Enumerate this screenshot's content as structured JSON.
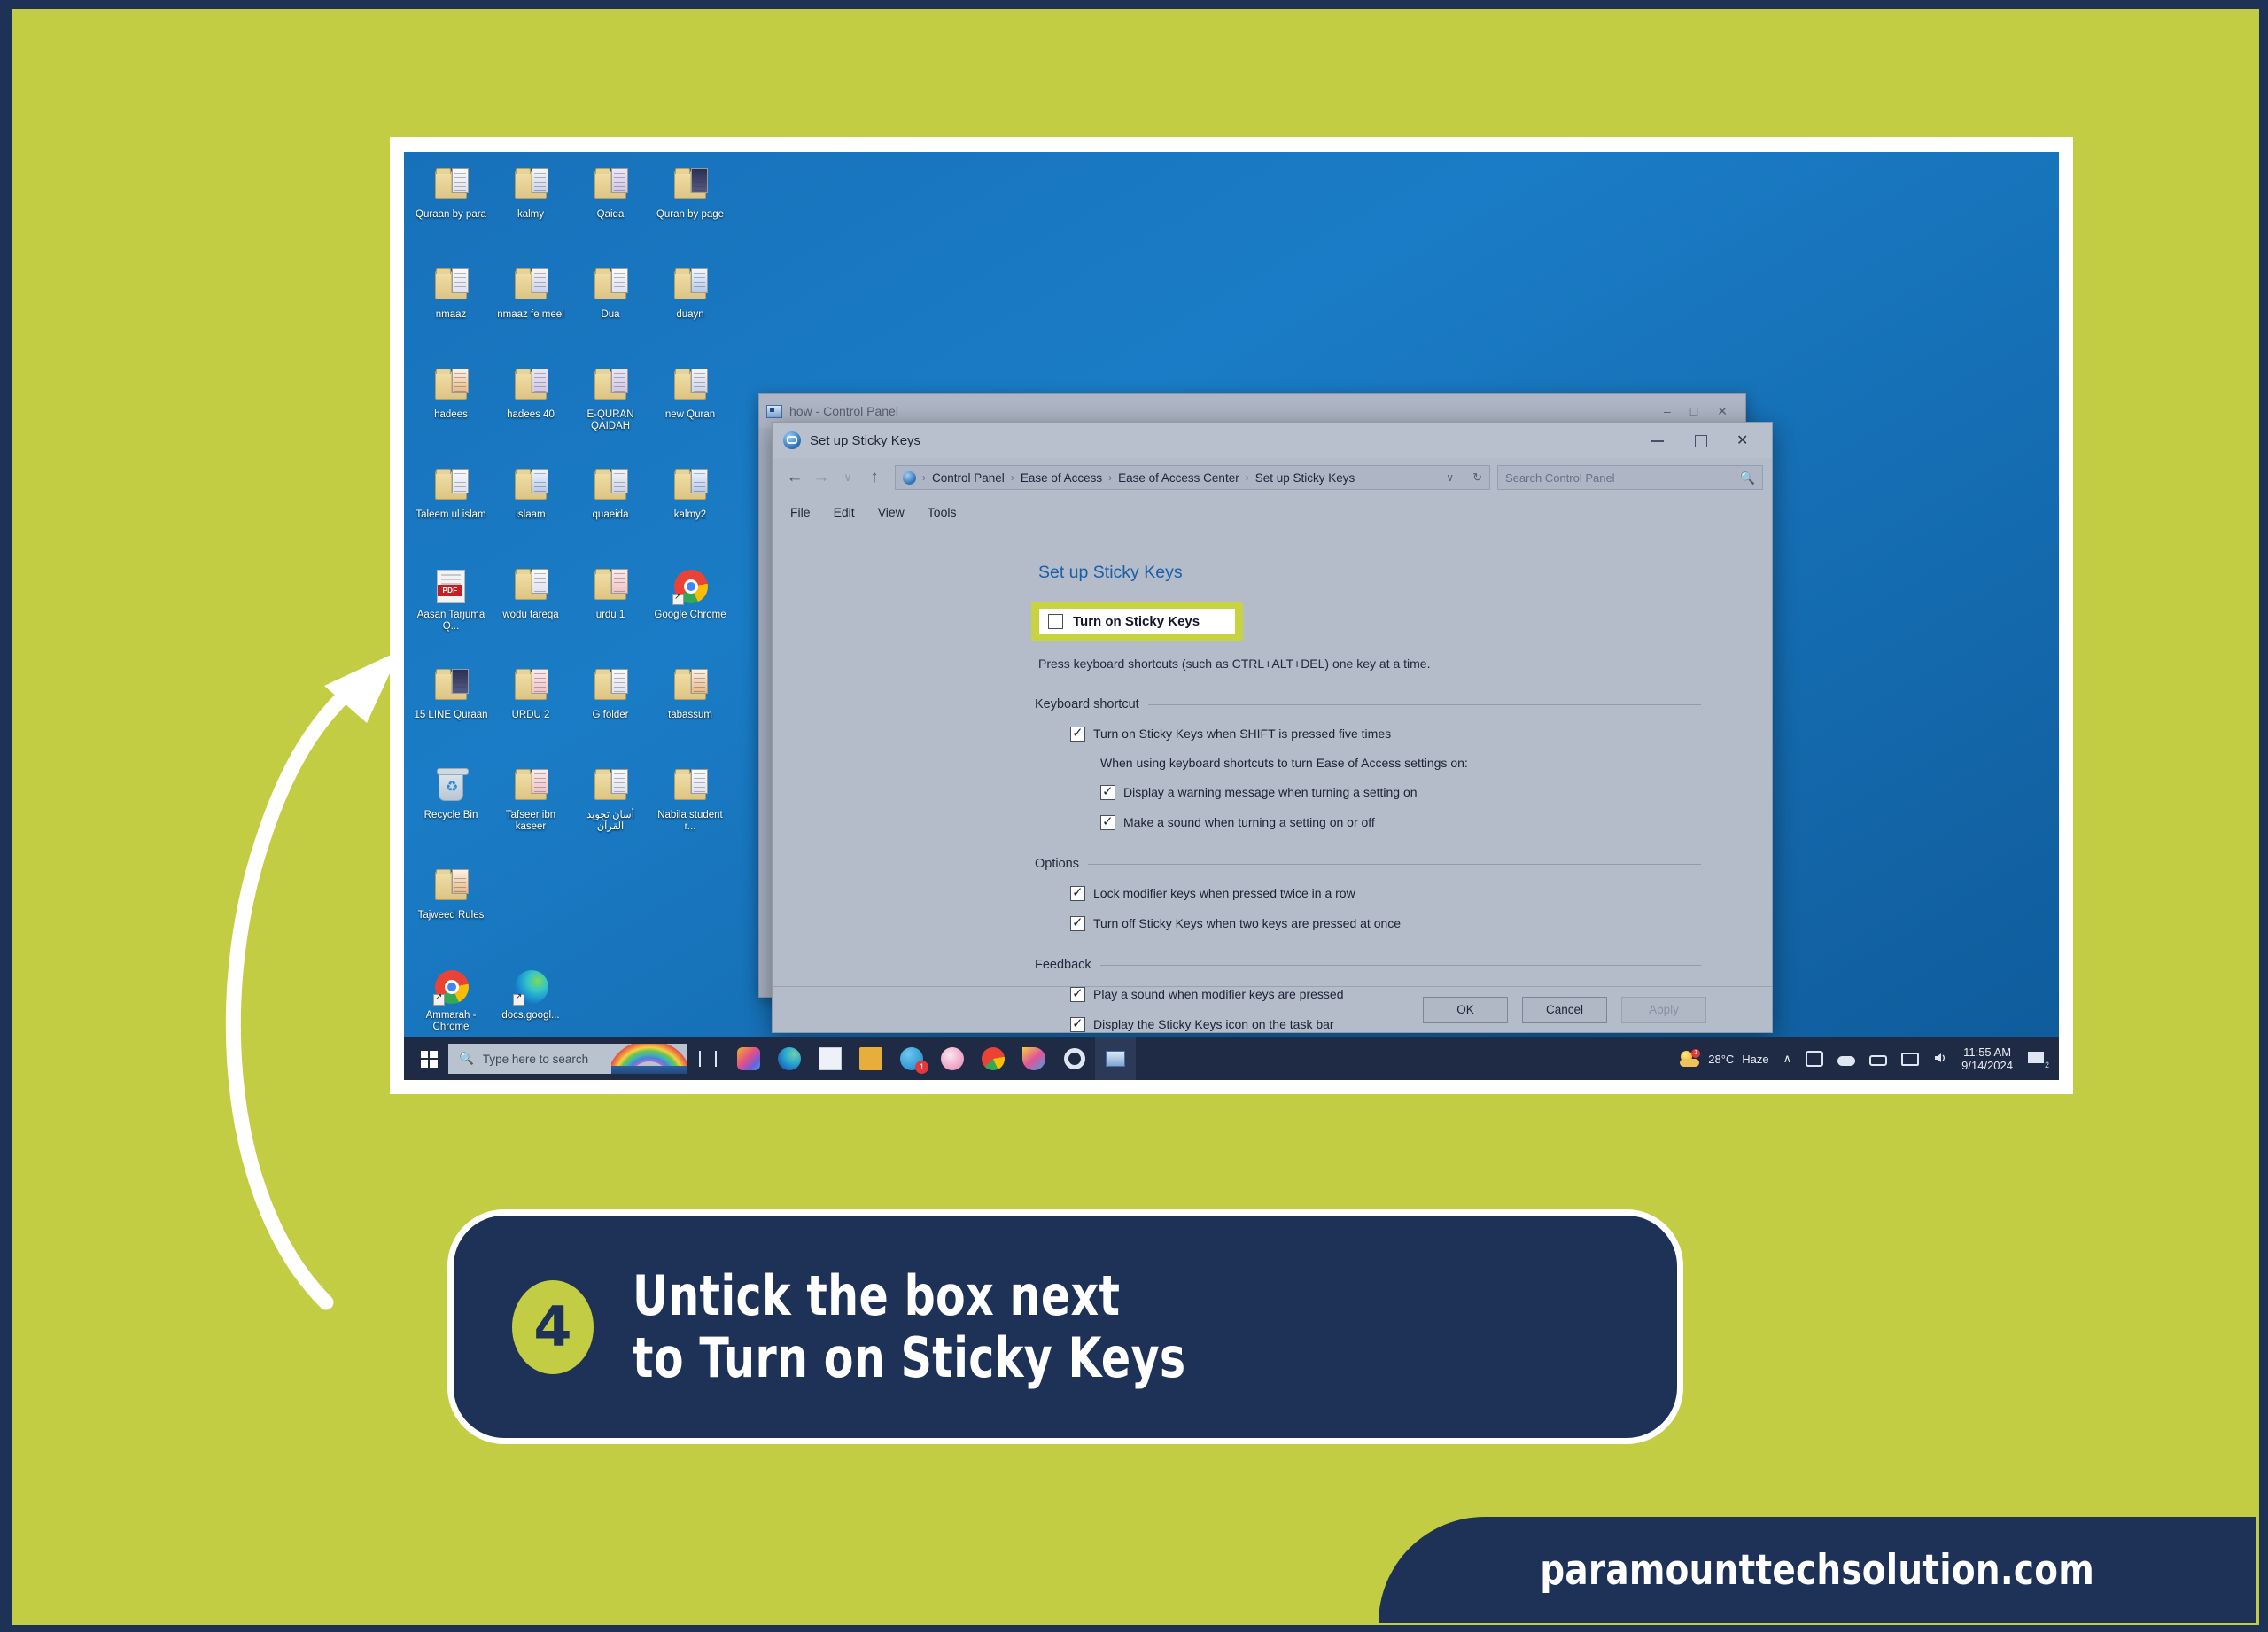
{
  "theme": {
    "lime": "#c2cd44",
    "navy": "#1e3258",
    "highlight": "#c8d340",
    "desktop_blue": "#1771ba",
    "taskbar": "#1f2a44"
  },
  "desktop": {
    "icons": [
      {
        "label": "Quraan by para",
        "type": "folder-paper",
        "tint": "tint-a"
      },
      {
        "label": "kalmy",
        "type": "folder-paper",
        "tint": "tint-d"
      },
      {
        "label": "Qaida",
        "type": "folder-paper",
        "tint": "tint-b"
      },
      {
        "label": "Quran by page",
        "type": "folder-paper",
        "tint": "tint-f"
      },
      {
        "label": "nmaaz",
        "type": "folder-paper",
        "tint": "tint-a"
      },
      {
        "label": "nmaaz fe meel",
        "type": "folder-paper",
        "tint": "tint-d"
      },
      {
        "label": "Dua",
        "type": "folder-paper",
        "tint": "tint-a"
      },
      {
        "label": "duayn",
        "type": "folder-paper",
        "tint": "tint-g"
      },
      {
        "label": "hadees",
        "type": "folder-paper",
        "tint": "tint-c"
      },
      {
        "label": "hadees 40",
        "type": "folder-paper",
        "tint": "tint-b"
      },
      {
        "label": "E-QURAN QAIDAH",
        "type": "folder-paper",
        "tint": "tint-b"
      },
      {
        "label": "new Quran",
        "type": "folder-paper",
        "tint": "tint-d"
      },
      {
        "label": "Taleem ul islam",
        "type": "folder-paper",
        "tint": "tint-a"
      },
      {
        "label": "islaam",
        "type": "folder-paper",
        "tint": "tint-g"
      },
      {
        "label": "quaeida",
        "type": "folder-paper",
        "tint": "tint-d"
      },
      {
        "label": "kalmy2",
        "type": "folder-paper",
        "tint": "tint-g"
      },
      {
        "label": "Aasan Tarjuma Q...",
        "type": "pdf",
        "tint": ""
      },
      {
        "label": "wodu tareqa",
        "type": "folder-paper",
        "tint": "tint-a"
      },
      {
        "label": "urdu 1",
        "type": "folder-paper",
        "tint": "tint-e"
      },
      {
        "label": "Google Chrome",
        "type": "chrome-shortcut",
        "tint": ""
      },
      {
        "label": "15 LINE Quraan",
        "type": "folder-paper",
        "tint": "tint-f"
      },
      {
        "label": "URDU 2",
        "type": "folder-paper",
        "tint": "tint-e"
      },
      {
        "label": "G folder",
        "type": "folder-paper",
        "tint": "tint-a"
      },
      {
        "label": "tabassum",
        "type": "folder-paper",
        "tint": "tint-c"
      },
      {
        "label": "Recycle Bin",
        "type": "recycle-bin",
        "tint": ""
      },
      {
        "label": "Tafseer ibn kaseer",
        "type": "folder-paper",
        "tint": "tint-e"
      },
      {
        "label": "أسان تجوید القرآن",
        "type": "folder-paper",
        "tint": "tint-a"
      },
      {
        "label": "Nabila student r...",
        "type": "folder-paper",
        "tint": "tint-a"
      },
      {
        "label": "Tajweed Rules",
        "type": "folder-paper",
        "tint": "tint-c"
      },
      {
        "label": "",
        "type": "blank",
        "tint": ""
      },
      {
        "label": "",
        "type": "blank",
        "tint": ""
      },
      {
        "label": "",
        "type": "blank",
        "tint": ""
      },
      {
        "label": "Ammarah - Chrome",
        "type": "chrome-shortcut",
        "tint": ""
      },
      {
        "label": "docs.googl...",
        "type": "edge-shortcut",
        "tint": ""
      }
    ]
  },
  "background_window": {
    "title": "how - Control Panel",
    "menu": [
      "File",
      "Edit",
      "View",
      "Tools"
    ]
  },
  "dialog": {
    "title": "Set up Sticky Keys",
    "window_buttons": {
      "minimize": "–",
      "maximize": "□",
      "close": "✕"
    },
    "breadcrumb": [
      "Control Panel",
      "Ease of Access",
      "Ease of Access Center",
      "Set up Sticky Keys"
    ],
    "breadcrumb_separator": "›",
    "address_dropdown": "∨",
    "refresh": "↻",
    "nav": {
      "back": "←",
      "forward": "→",
      "recent": "∨",
      "up": "↑"
    },
    "search": {
      "placeholder": "Search Control Panel",
      "icon": "search-icon"
    },
    "menu": [
      "File",
      "Edit",
      "View",
      "Tools"
    ],
    "heading": "Set up Sticky Keys",
    "main_checkbox": {
      "label": "Turn on Sticky Keys",
      "checked": false,
      "highlighted": true
    },
    "hint": "Press keyboard shortcuts (such as CTRL+ALT+DEL) one key at a time.",
    "groups": [
      {
        "title": "Keyboard shortcut",
        "items": [
          {
            "label": "Turn on Sticky Keys when SHIFT is pressed five times",
            "checked": true,
            "indent": 1
          },
          {
            "label": "When using keyboard shortcuts to turn Ease of Access settings on:",
            "checked": null,
            "indent": 2
          },
          {
            "label": "Display a warning message when turning a setting on",
            "checked": true,
            "indent": 2
          },
          {
            "label": "Make a sound when turning a setting on or off",
            "checked": true,
            "indent": 2
          }
        ]
      },
      {
        "title": "Options",
        "items": [
          {
            "label": "Lock modifier keys when pressed twice in a row",
            "checked": true,
            "indent": 1
          },
          {
            "label": "Turn off Sticky Keys when two keys are pressed at once",
            "checked": true,
            "indent": 1
          }
        ]
      },
      {
        "title": "Feedback",
        "items": [
          {
            "label": "Play a sound when modifier keys are pressed",
            "checked": true,
            "indent": 1
          },
          {
            "label": "Display the Sticky Keys icon on the task bar",
            "checked": true,
            "indent": 1
          }
        ]
      }
    ],
    "buttons": {
      "ok": "OK",
      "cancel": "Cancel",
      "apply": "Apply",
      "apply_disabled": true
    }
  },
  "taskbar": {
    "start": "start-button",
    "search_placeholder": "Type here to search",
    "search_icon": "search-icon",
    "icons": [
      {
        "name": "task-view-icon"
      },
      {
        "name": "widgets-icon"
      },
      {
        "name": "edge-icon"
      },
      {
        "name": "mail-icon"
      },
      {
        "name": "file-explorer-icon"
      },
      {
        "name": "skype-icon",
        "badge": "1"
      },
      {
        "name": "snip-sketch-icon"
      },
      {
        "name": "chrome-icon"
      },
      {
        "name": "paint-icon"
      },
      {
        "name": "settings-icon"
      },
      {
        "name": "control-panel-icon",
        "active": true
      }
    ],
    "tray": {
      "weather_temp": "28°C",
      "weather_desc": "Haze",
      "weather_badge": "1",
      "chevron": "∧",
      "icons": [
        "onedrive-icon",
        "cloud-icon",
        "battery-icon",
        "network-icon",
        "volume-icon"
      ],
      "time": "11:55 AM",
      "date": "9/14/2024",
      "notification_badge": "2"
    }
  },
  "banner": {
    "step": "4",
    "line1": "Untick the box next",
    "line2": "to Turn on Sticky Keys"
  },
  "footer": {
    "site": "paramounttechsolution.com"
  }
}
